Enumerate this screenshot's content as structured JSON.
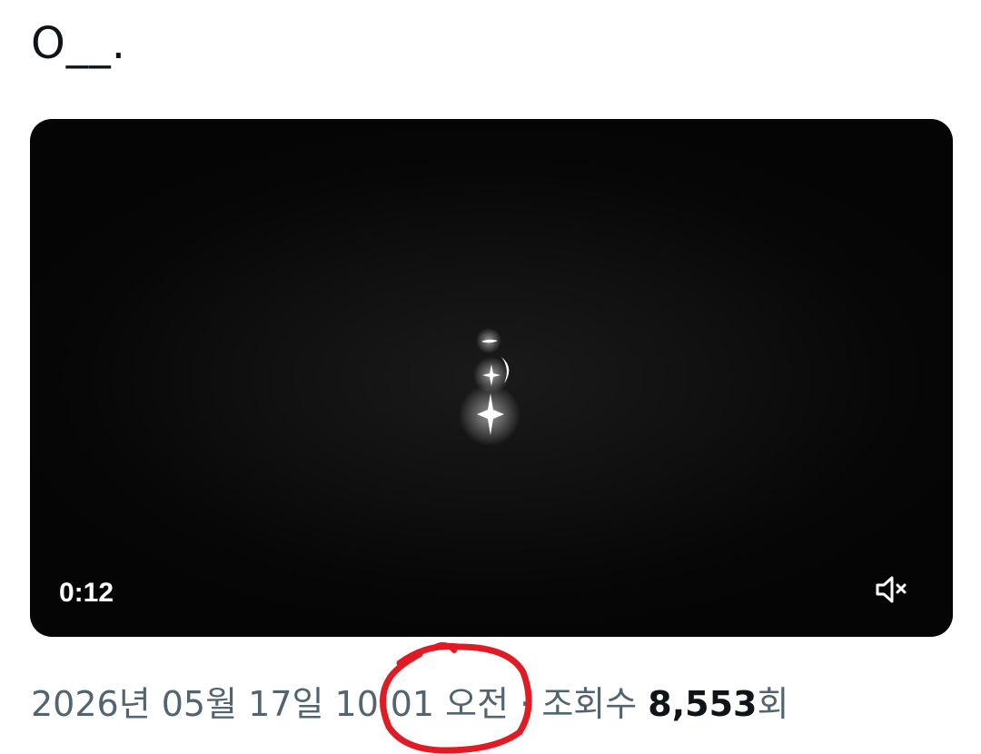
{
  "post": {
    "text": "O__."
  },
  "video": {
    "time": "0:12",
    "mute_icon": "speaker-muted-icon",
    "art_icon": "sparkle-moon-icon"
  },
  "meta": {
    "date": "2026년 05월 17일 ",
    "time": "10:01",
    "ampm": " 오전",
    "separator": " · ",
    "views_label": "조회수 ",
    "views_count": "8,553",
    "views_suffix": "회"
  },
  "annotation": {
    "color": "#e01b24",
    "shape": "hand-drawn-circle"
  }
}
